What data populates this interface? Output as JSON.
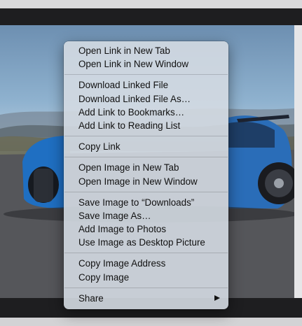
{
  "colors": {
    "menu_background": "#d4dae2",
    "menu_text": "#111111"
  },
  "image": {
    "subject": "blue sports car on mountain road"
  },
  "context_menu": {
    "groups": [
      {
        "items": [
          {
            "label": "Open Link in New Tab"
          },
          {
            "label": "Open Link in New Window"
          }
        ]
      },
      {
        "items": [
          {
            "label": "Download Linked File"
          },
          {
            "label": "Download Linked File As…"
          },
          {
            "label": "Add Link to Bookmarks…"
          },
          {
            "label": "Add Link to Reading List"
          }
        ]
      },
      {
        "items": [
          {
            "label": "Copy Link"
          }
        ]
      },
      {
        "items": [
          {
            "label": "Open Image in New Tab"
          },
          {
            "label": "Open Image in New Window"
          }
        ]
      },
      {
        "items": [
          {
            "label": "Save Image to “Downloads”"
          },
          {
            "label": "Save Image As…"
          },
          {
            "label": "Add Image to Photos"
          },
          {
            "label": "Use Image as Desktop Picture"
          }
        ]
      },
      {
        "items": [
          {
            "label": "Copy Image Address"
          },
          {
            "label": "Copy Image"
          }
        ]
      },
      {
        "items": [
          {
            "label": "Share",
            "submenu": true,
            "icon": "chevron-right-icon"
          }
        ]
      }
    ]
  }
}
